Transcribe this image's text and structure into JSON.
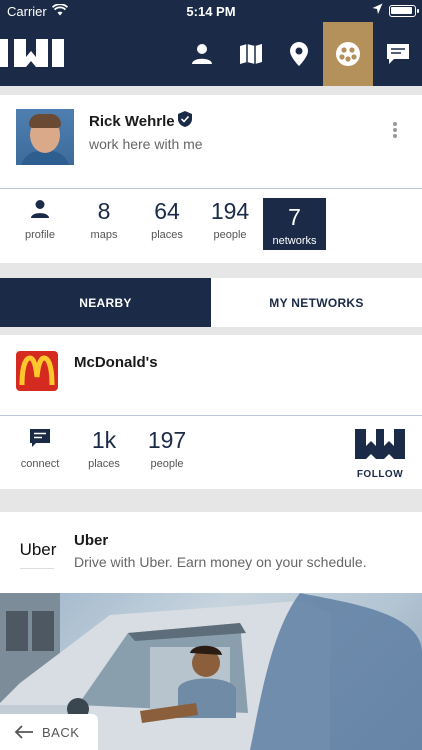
{
  "status_bar": {
    "carrier": "Carrier",
    "time": "5:14 PM"
  },
  "nav": {
    "icons": [
      "logo-icon",
      "person-icon",
      "map-icon",
      "location-pin-icon",
      "networks-icon",
      "chat-icon"
    ],
    "active_icon": "networks-icon",
    "colors": {
      "navy": "#1b2a47",
      "active": "#b4915b"
    }
  },
  "profile": {
    "name": "Rick Wehrle",
    "subtitle": "work here with me",
    "stats": [
      {
        "num": "",
        "label": "profile"
      },
      {
        "num": "8",
        "label": "maps"
      },
      {
        "num": "64",
        "label": "places"
      },
      {
        "num": "194",
        "label": "people"
      },
      {
        "num": "7",
        "label": "networks"
      }
    ]
  },
  "tabs": {
    "nearby": "NEARBY",
    "my_networks": "MY NETWORKS",
    "active": "NEARBY"
  },
  "networks": [
    {
      "name": "McDonald's",
      "stats": [
        {
          "num": "",
          "label": "connect"
        },
        {
          "num": "1k",
          "label": "places"
        },
        {
          "num": "197",
          "label": "people"
        }
      ],
      "follow": "FOLLOW"
    },
    {
      "name": "Uber",
      "logo_text": "Uber",
      "description": "Drive with Uber. Earn money on your schedule."
    }
  ],
  "back_button": {
    "label": "BACK"
  }
}
